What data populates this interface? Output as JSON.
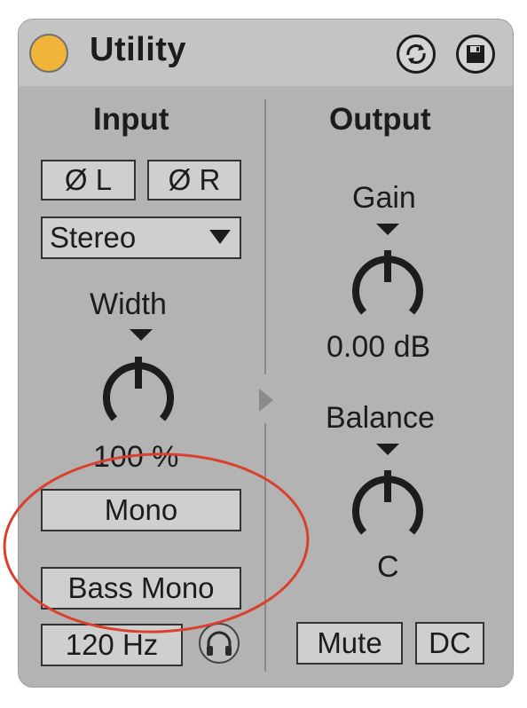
{
  "device": {
    "title": "Utility",
    "icons": {
      "power": "power-led-icon",
      "hot_swap": "hot-swap-icon",
      "save": "save-preset-icon",
      "headphones": "headphones-icon"
    },
    "colors": {
      "power_led": "#f0b43a",
      "panel": "#b3b3b3",
      "button": "#cfcfcf",
      "annotation": "#d9412e"
    }
  },
  "input": {
    "heading": "Input",
    "phase_left": "Ø L",
    "phase_right": "Ø R",
    "channel_mode": "Stereo",
    "width_label": "Width",
    "width_value": "100 %",
    "mono_button": "Mono",
    "bass_mono_button": "Bass Mono",
    "bass_mono_freq": "120 Hz"
  },
  "output": {
    "heading": "Output",
    "gain_label": "Gain",
    "gain_value": "0.00 dB",
    "balance_label": "Balance",
    "balance_value": "C",
    "mute_button": "Mute",
    "dc_button": "DC"
  }
}
